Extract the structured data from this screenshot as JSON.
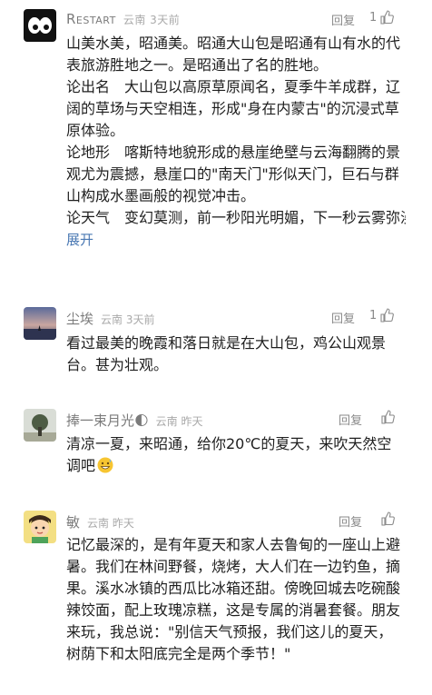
{
  "comments": [
    {
      "author": "Restart",
      "location": "云南",
      "time": "3天前",
      "reply_label": "回复",
      "likes": "1",
      "paragraphs": [
        "山美水美，昭通美。昭通大山包是昭通有山有水的代表旅游胜地之一。是昭通出了名的胜地。",
        "论出名　大山包以高原草原闻名，夏季牛羊成群，辽阔的草场与天空相连，形成\"身在内蒙古\"的沉浸式草原体验。",
        "论地形　喀斯特地貌形成的悬崖绝壁与云海翻腾的景观尤为震撼，悬崖口的\"南天门\"形似天门，巨石与群山构成水墨画般的视觉冲击。",
        "论天气　变幻莫测，前一秒阳光明媚，下一秒云雾弥漫，形成\"肉眼可见\"的天地转换，增添旅行…"
      ],
      "expand_label": "展开"
    },
    {
      "author": "尘埃",
      "location": "云南",
      "time": "3天前",
      "reply_label": "回复",
      "likes": "1",
      "paragraphs": [
        "看过最美的晚霞和落日就是在大山包，鸡公山观景台。甚为壮观。"
      ]
    },
    {
      "author": "捧一束月光🌓",
      "location": "云南",
      "time": "昨天",
      "reply_label": "回复",
      "likes": "",
      "paragraphs": [
        "清凉一夏，来昭通，给你20℃的夏天，来吹天然空调吧"
      ],
      "emoji": "grinning-sweat-emoji"
    },
    {
      "author": "敏",
      "location": "云南",
      "time": "昨天",
      "reply_label": "回复",
      "likes": "",
      "paragraphs": [
        "记忆最深的，是有年夏天和家人去鲁甸的一座山上避暑。我们在林间野餐，烧烤，大人们在一边钓鱼，摘果。溪水冰镇的西瓜比冰箱还甜。傍晚回城去吃碗酸辣饺面，配上玫瑰凉糕，这是专属的消暑套餐。朋友来玩，我总说：\"别信天气预报，我们这儿的夏天，树荫下和太阳底完全是两个季节！\""
      ]
    }
  ],
  "icons": {
    "like": "thumbs-up-icon"
  }
}
